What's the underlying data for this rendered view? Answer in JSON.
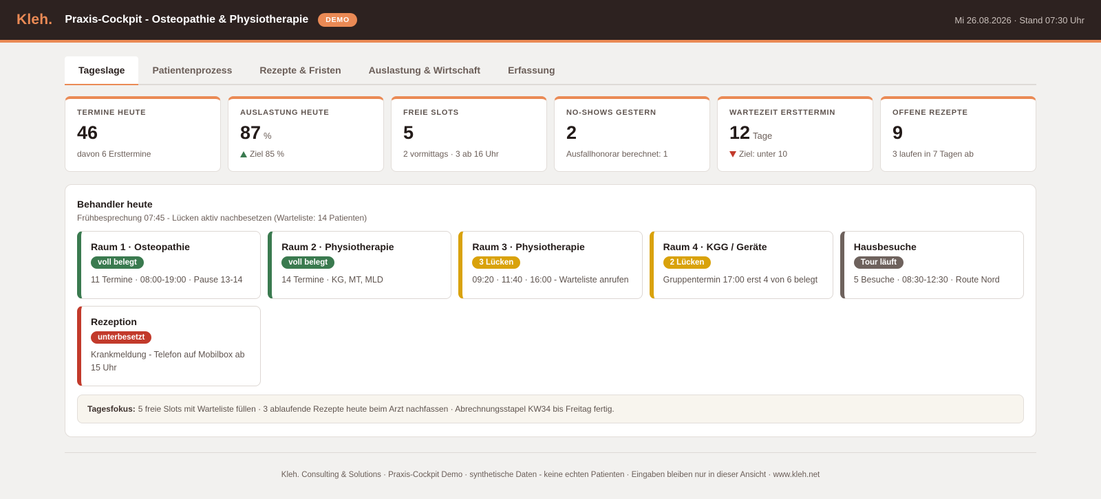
{
  "header": {
    "logo": "Kleh.",
    "title": "Praxis-Cockpit - Osteopathie & Physiotherapie",
    "badge": "DEMO",
    "datetime": "Mi 26.08.2026 · Stand 07:30 Uhr"
  },
  "tabs": [
    {
      "label": "Tageslage",
      "active": true
    },
    {
      "label": "Patientenprozess",
      "active": false
    },
    {
      "label": "Rezepte & Fristen",
      "active": false
    },
    {
      "label": "Auslastung & Wirtschaft",
      "active": false
    },
    {
      "label": "Erfassung",
      "active": false
    }
  ],
  "kpis": [
    {
      "label": "TERMINE HEUTE",
      "value": "46",
      "unit": "",
      "note": "davon 6 Ersttermine",
      "trend": ""
    },
    {
      "label": "AUSLASTUNG HEUTE",
      "value": "87",
      "unit": "%",
      "note": "Ziel 85 %",
      "trend": "up"
    },
    {
      "label": "FREIE SLOTS",
      "value": "5",
      "unit": "",
      "note": "2 vormittags · 3 ab 16 Uhr",
      "trend": ""
    },
    {
      "label": "NO-SHOWS GESTERN",
      "value": "2",
      "unit": "",
      "note": "Ausfallhonorar berechnet: 1",
      "trend": ""
    },
    {
      "label": "WARTEZEIT ERSTTERMIN",
      "value": "12",
      "unit": "Tage",
      "note": "Ziel: unter 10",
      "trend": "down"
    },
    {
      "label": "OFFENE REZEPTE",
      "value": "9",
      "unit": "",
      "note": "3 laufen in 7 Tagen ab",
      "trend": ""
    }
  ],
  "panel": {
    "title": "Behandler heute",
    "subtitle": "Frühbesprechung 07:45 - Lücken aktiv nachbesetzen (Warteliste: 14 Patienten)",
    "rooms": [
      {
        "title": "Raum 1 · Osteopathie",
        "badge": "voll belegt",
        "color": "#3a7a4f",
        "note": "11 Termine · 08:00-19:00 · Pause 13-14"
      },
      {
        "title": "Raum 2 · Physiotherapie",
        "badge": "voll belegt",
        "color": "#3a7a4f",
        "note": "14 Termine · KG, MT, MLD"
      },
      {
        "title": "Raum 3 · Physiotherapie",
        "badge": "3 Lücken",
        "color": "#d9a20b",
        "note": "09:20 · 11:40 · 16:00 - Warteliste anrufen"
      },
      {
        "title": "Raum 4 · KGG / Geräte",
        "badge": "2 Lücken",
        "color": "#d9a20b",
        "note": "Gruppentermin 17:00 erst 4 von 6 belegt"
      },
      {
        "title": "Hausbesuche",
        "badge": "Tour läuft",
        "color": "#6e625d",
        "note": "5 Besuche · 08:30-12:30 · Route Nord"
      },
      {
        "title": "Rezeption",
        "badge": "unterbesetzt",
        "color": "#c23a2b",
        "note": "Krankmeldung - Telefon auf Mobilbox ab 15 Uhr"
      }
    ],
    "focus_label": "Tagesfokus:",
    "focus_text": "5 freie Slots mit Warteliste füllen · 3 ablaufende Rezepte heute beim Arzt nachfassen · Abrechnungsstapel KW34 bis Freitag fertig."
  },
  "footer": "Kleh. Consulting & Solutions · Praxis-Cockpit Demo · synthetische Daten - keine echten Patienten · Eingaben bleiben nur in dieser Ansicht · www.kleh.net"
}
